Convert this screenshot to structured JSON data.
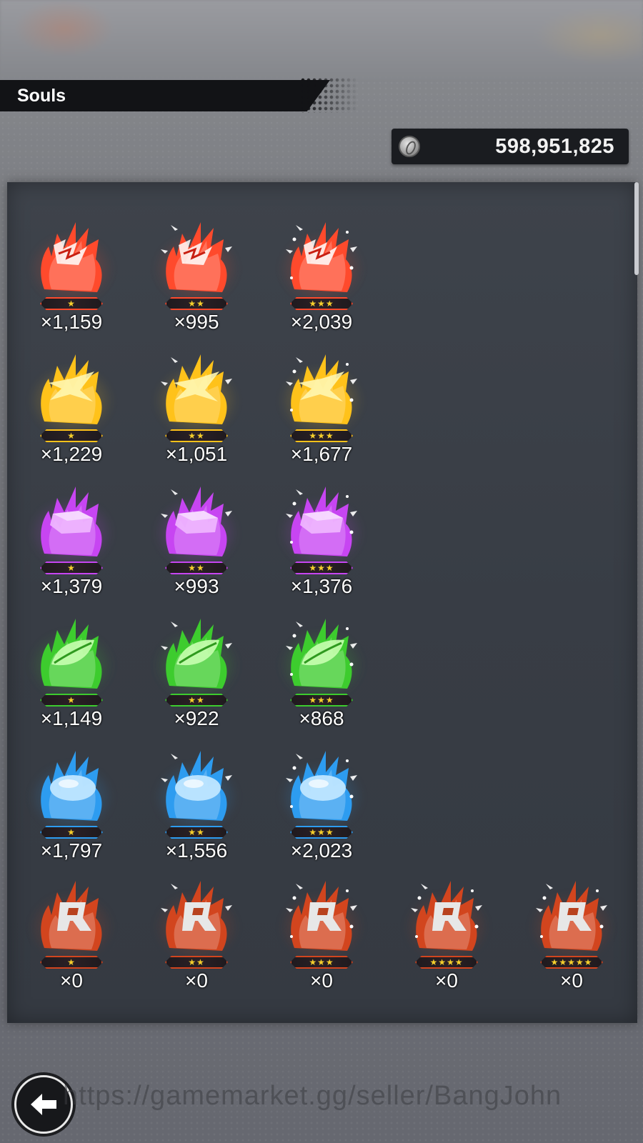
{
  "header": {
    "title": "Souls"
  },
  "currency": {
    "icon": "coin-icon",
    "value": "598,951,825"
  },
  "grid": {
    "rows": [
      {
        "kind": "red-lightning",
        "color": "#ff4a2c",
        "items": [
          {
            "stars": "★",
            "count": "×1,159"
          },
          {
            "stars": "★★",
            "count": "×995"
          },
          {
            "stars": "★★★",
            "count": "×2,039"
          }
        ]
      },
      {
        "kind": "yellow-star",
        "color": "#ffc21a",
        "items": [
          {
            "stars": "★",
            "count": "×1,229"
          },
          {
            "stars": "★★",
            "count": "×1,051"
          },
          {
            "stars": "★★★",
            "count": "×1,677"
          }
        ]
      },
      {
        "kind": "purple-crystal",
        "color": "#c745f2",
        "items": [
          {
            "stars": "★",
            "count": "×1,379"
          },
          {
            "stars": "★★",
            "count": "×993"
          },
          {
            "stars": "★★★",
            "count": "×1,376"
          }
        ]
      },
      {
        "kind": "green-leaf",
        "color": "#3dcc2e",
        "items": [
          {
            "stars": "★",
            "count": "×1,149"
          },
          {
            "stars": "★★",
            "count": "×922"
          },
          {
            "stars": "★★★",
            "count": "×868"
          }
        ]
      },
      {
        "kind": "blue-drop",
        "color": "#2d9cf0",
        "items": [
          {
            "stars": "★",
            "count": "×1,797"
          },
          {
            "stars": "★★",
            "count": "×1,556"
          },
          {
            "stars": "★★★",
            "count": "×2,023"
          }
        ]
      },
      {
        "kind": "rainbow-r",
        "color": "#d2451e",
        "items": [
          {
            "stars": "★",
            "count": "×0"
          },
          {
            "stars": "★★",
            "count": "×0"
          },
          {
            "stars": "★★★",
            "count": "×0"
          },
          {
            "stars": "★★★★",
            "count": "×0"
          },
          {
            "stars": "★★★★★",
            "count": "×0"
          }
        ]
      }
    ]
  },
  "footer": {
    "back_icon": "back-arrow-icon",
    "watermark": "https://gamemarket.gg/seller/BangJohn"
  }
}
